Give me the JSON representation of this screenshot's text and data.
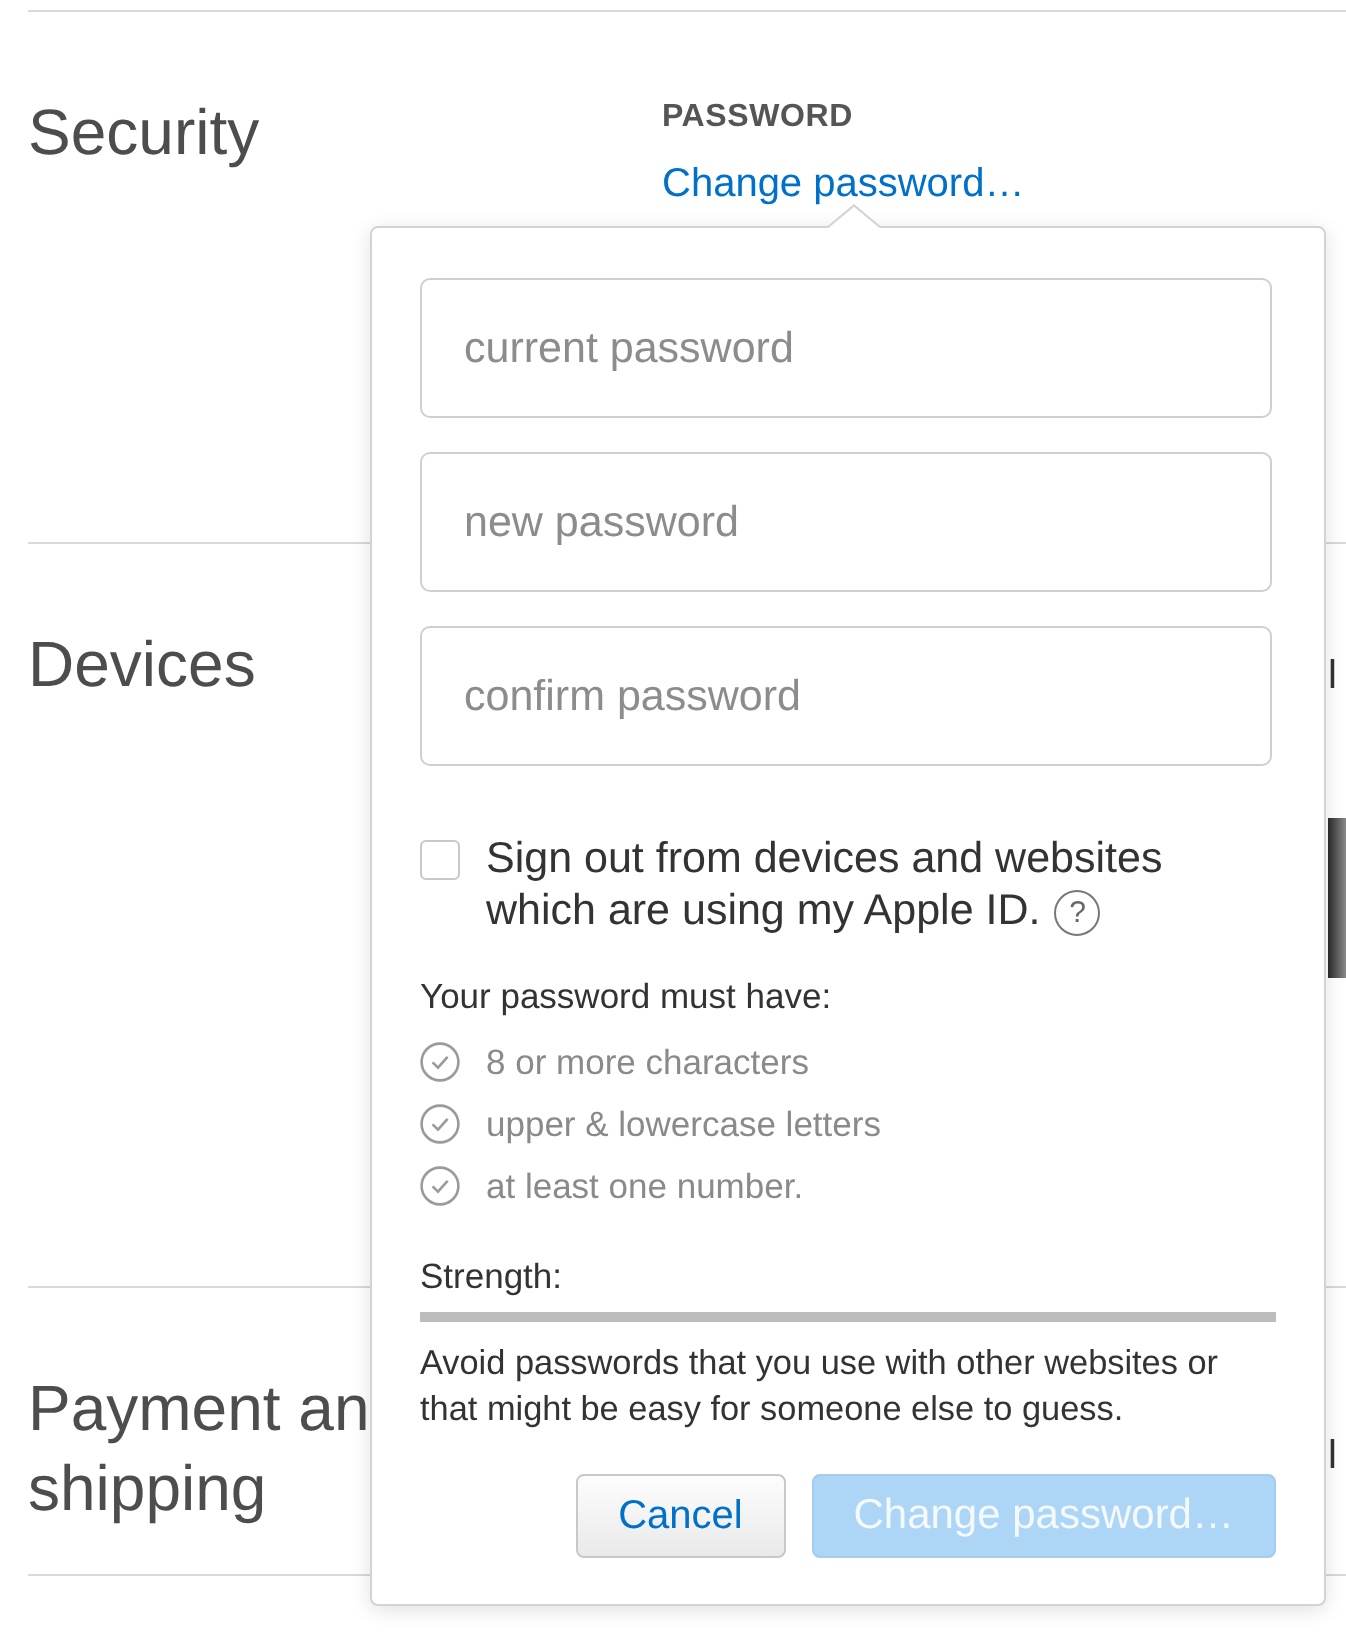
{
  "sections": [
    {
      "title": "Security",
      "field_label": "PASSWORD",
      "link": "Change password…"
    },
    {
      "title": "Devices",
      "side_items": [
        {
          "kind": "text",
          "text": "l"
        },
        {
          "kind": "photo"
        }
      ]
    },
    {
      "title": "Payment an\nshipping",
      "side_items": [
        {
          "kind": "text",
          "text": "l"
        }
      ]
    }
  ],
  "popover": {
    "fields": [
      {
        "placeholder": "current password"
      },
      {
        "placeholder": "new password"
      },
      {
        "placeholder": "confirm password"
      }
    ],
    "sign_out": {
      "label_lines": [
        "Sign out from devices and websites",
        "which are using my Apple ID."
      ],
      "checked": false,
      "help": "?"
    },
    "requirements_title": "Your password must have:",
    "requirements": [
      {
        "text": "8 or more characters",
        "met": false
      },
      {
        "text": "upper & lowercase letters",
        "met": false
      },
      {
        "text": "at least one number.",
        "met": false
      }
    ],
    "strength": {
      "label": "Strength:",
      "level": 0
    },
    "advice": "Avoid passwords that you use with other websites or that might be easy for someone else to guess.",
    "buttons": [
      {
        "label": "Cancel",
        "kind": "secondary",
        "disabled": false
      },
      {
        "label": "Change password…",
        "kind": "primary",
        "disabled": true
      }
    ]
  }
}
